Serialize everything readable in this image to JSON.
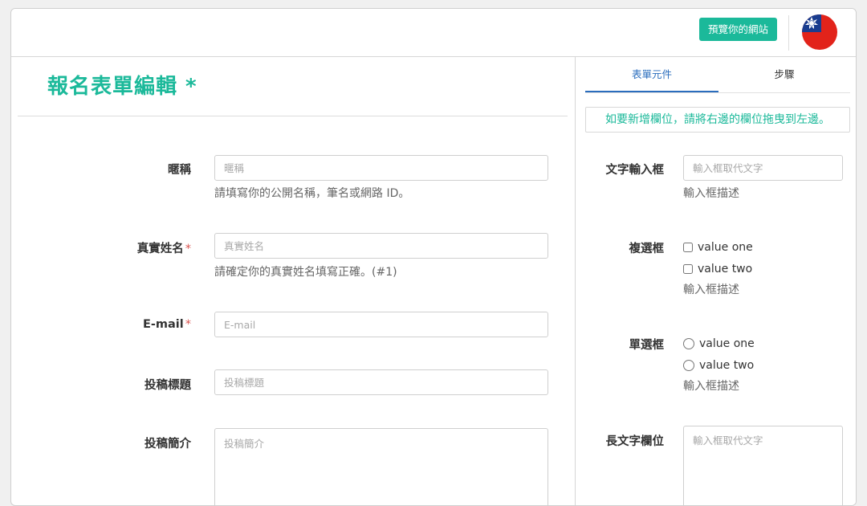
{
  "topbar": {
    "preview_label": "預覽你的網站",
    "flag_icon": "taiwan-flag-icon",
    "colors": {
      "accent": "#1bb99a",
      "flag_red": "#e2231a",
      "flag_blue": "#1a3d8f"
    }
  },
  "form": {
    "title": "報名表單編輯 *",
    "fields": [
      {
        "label": "暱稱",
        "required": false,
        "placeholder": "暱稱",
        "help": "請填寫你的公開名稱，筆名或網路 ID。"
      },
      {
        "label": "真實姓名",
        "required": true,
        "placeholder": "真實姓名",
        "help": "請確定你的真實姓名填寫正確。(#1)"
      },
      {
        "label": "E-mail",
        "required": true,
        "placeholder": "E-mail",
        "help": ""
      },
      {
        "label": "投稿標題",
        "required": false,
        "placeholder": "投稿標題",
        "help": ""
      },
      {
        "label": "投稿簡介",
        "required": false,
        "placeholder": "投稿簡介",
        "help": ""
      }
    ],
    "required_mark": "*"
  },
  "sidebar": {
    "tabs": [
      {
        "label": "表單元件",
        "active": true
      },
      {
        "label": "步驟",
        "active": false
      }
    ],
    "hint": "如要新增欄位，請將右邊的欄位拖曳到左邊。",
    "components": [
      {
        "label": "文字輸入框",
        "kind": "text",
        "placeholder": "輸入框取代文字",
        "desc": "輸入框描述"
      },
      {
        "label": "複選框",
        "kind": "checkbox",
        "options": [
          "value one",
          "value two"
        ],
        "desc": "輸入框描述"
      },
      {
        "label": "單選框",
        "kind": "radio",
        "options": [
          "value one",
          "value two"
        ],
        "desc": "輸入框描述"
      },
      {
        "label": "長文字欄位",
        "kind": "textarea",
        "placeholder": "輸入框取代文字"
      }
    ]
  }
}
